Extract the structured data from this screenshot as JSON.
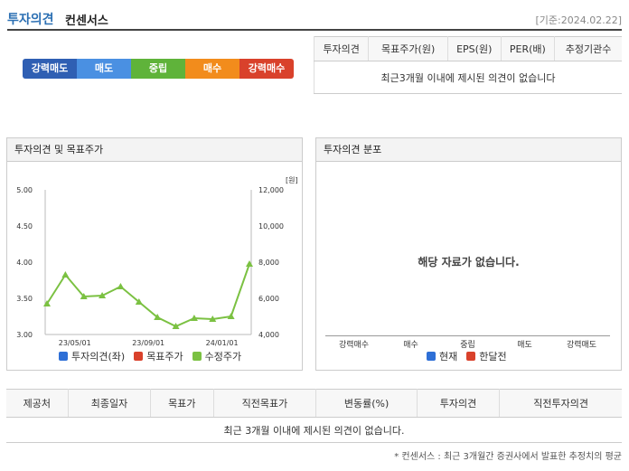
{
  "header": {
    "title_main": "투자의견",
    "title_sub": "컨센서스",
    "date": "[기준:2024.02.22]"
  },
  "scale": [
    {
      "label": "강력매도",
      "color": "#2f5fb3"
    },
    {
      "label": "매도",
      "color": "#4a90e2"
    },
    {
      "label": "중립",
      "color": "#5fb33a"
    },
    {
      "label": "매수",
      "color": "#f28c1c"
    },
    {
      "label": "강력매수",
      "color": "#d9412b"
    }
  ],
  "summary": {
    "headers": [
      "투자의견",
      "목표주가(원)",
      "EPS(원)",
      "PER(배)",
      "추정기관수"
    ],
    "message": "최근3개월 이내에 제시된 의견이 없습니다"
  },
  "panel_left": {
    "title": "투자의견 및 목표주가"
  },
  "panel_right": {
    "title": "투자의견 분포",
    "message": "해당 자료가 없습니다.",
    "categories": [
      "강력매수",
      "매수",
      "중립",
      "매도",
      "강력매도"
    ]
  },
  "legend_left": [
    {
      "label": "투자의견(좌)",
      "color": "#2e6fd6"
    },
    {
      "label": "목표주가",
      "color": "#d9412b"
    },
    {
      "label": "수정주가",
      "color": "#7bc142"
    }
  ],
  "legend_right": [
    {
      "label": "현재",
      "color": "#2e6fd6"
    },
    {
      "label": "한달전",
      "color": "#d9412b"
    }
  ],
  "chart_data": {
    "type": "line",
    "ylabel_right": "[원]",
    "y_left": {
      "ticks": [
        "5.00",
        "4.50",
        "4.00",
        "3.50",
        "3.00"
      ],
      "range": [
        3.0,
        5.0
      ]
    },
    "y_right": {
      "ticks": [
        "12,000",
        "10,000",
        "8,000",
        "6,000",
        "4,000"
      ],
      "range": [
        4000,
        12000
      ]
    },
    "x_ticks": [
      "23/05/01",
      "23/09/01",
      "24/01/01"
    ],
    "series": [
      {
        "name": "수정주가",
        "values": [
          5700,
          7300,
          6100,
          6150,
          6650,
          5800,
          4950,
          4450,
          4900,
          4850,
          5000,
          7900
        ]
      }
    ]
  },
  "bottom": {
    "headers": [
      "제공처",
      "최종일자",
      "목표가",
      "직전목표가",
      "변동률(%)",
      "투자의견",
      "직전투자의견"
    ],
    "message": "최근 3개월 이내에 제시된 의견이 없습니다."
  },
  "footnote": "* 컨센서스 : 최근 3개월간 증권사에서 발표한 추정치의 평균"
}
